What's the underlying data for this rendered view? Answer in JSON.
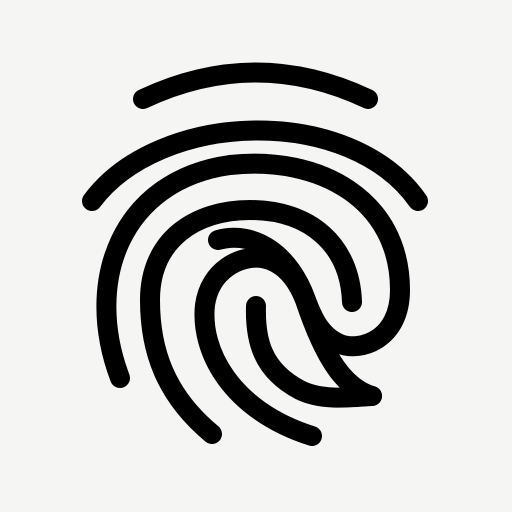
{
  "icon": {
    "name": "fingerprint-icon",
    "stroke_color": "#000000",
    "background_color": "#f5f6f4"
  }
}
